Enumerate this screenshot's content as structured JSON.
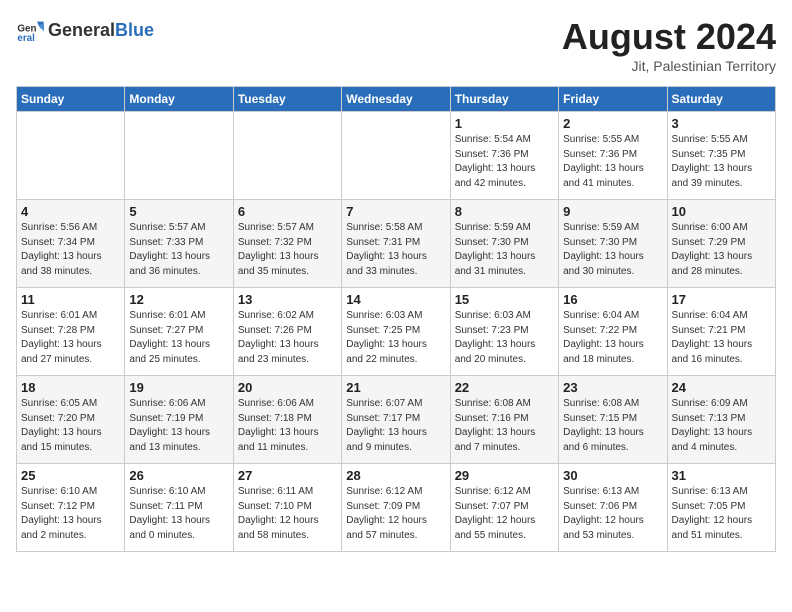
{
  "header": {
    "logo_general": "General",
    "logo_blue": "Blue",
    "month_year": "August 2024",
    "location": "Jit, Palestinian Territory"
  },
  "weekdays": [
    "Sunday",
    "Monday",
    "Tuesday",
    "Wednesday",
    "Thursday",
    "Friday",
    "Saturday"
  ],
  "weeks": [
    [
      {
        "day": "",
        "info": ""
      },
      {
        "day": "",
        "info": ""
      },
      {
        "day": "",
        "info": ""
      },
      {
        "day": "",
        "info": ""
      },
      {
        "day": "1",
        "info": "Sunrise: 5:54 AM\nSunset: 7:36 PM\nDaylight: 13 hours\nand 42 minutes."
      },
      {
        "day": "2",
        "info": "Sunrise: 5:55 AM\nSunset: 7:36 PM\nDaylight: 13 hours\nand 41 minutes."
      },
      {
        "day": "3",
        "info": "Sunrise: 5:55 AM\nSunset: 7:35 PM\nDaylight: 13 hours\nand 39 minutes."
      }
    ],
    [
      {
        "day": "4",
        "info": "Sunrise: 5:56 AM\nSunset: 7:34 PM\nDaylight: 13 hours\nand 38 minutes."
      },
      {
        "day": "5",
        "info": "Sunrise: 5:57 AM\nSunset: 7:33 PM\nDaylight: 13 hours\nand 36 minutes."
      },
      {
        "day": "6",
        "info": "Sunrise: 5:57 AM\nSunset: 7:32 PM\nDaylight: 13 hours\nand 35 minutes."
      },
      {
        "day": "7",
        "info": "Sunrise: 5:58 AM\nSunset: 7:31 PM\nDaylight: 13 hours\nand 33 minutes."
      },
      {
        "day": "8",
        "info": "Sunrise: 5:59 AM\nSunset: 7:30 PM\nDaylight: 13 hours\nand 31 minutes."
      },
      {
        "day": "9",
        "info": "Sunrise: 5:59 AM\nSunset: 7:30 PM\nDaylight: 13 hours\nand 30 minutes."
      },
      {
        "day": "10",
        "info": "Sunrise: 6:00 AM\nSunset: 7:29 PM\nDaylight: 13 hours\nand 28 minutes."
      }
    ],
    [
      {
        "day": "11",
        "info": "Sunrise: 6:01 AM\nSunset: 7:28 PM\nDaylight: 13 hours\nand 27 minutes."
      },
      {
        "day": "12",
        "info": "Sunrise: 6:01 AM\nSunset: 7:27 PM\nDaylight: 13 hours\nand 25 minutes."
      },
      {
        "day": "13",
        "info": "Sunrise: 6:02 AM\nSunset: 7:26 PM\nDaylight: 13 hours\nand 23 minutes."
      },
      {
        "day": "14",
        "info": "Sunrise: 6:03 AM\nSunset: 7:25 PM\nDaylight: 13 hours\nand 22 minutes."
      },
      {
        "day": "15",
        "info": "Sunrise: 6:03 AM\nSunset: 7:23 PM\nDaylight: 13 hours\nand 20 minutes."
      },
      {
        "day": "16",
        "info": "Sunrise: 6:04 AM\nSunset: 7:22 PM\nDaylight: 13 hours\nand 18 minutes."
      },
      {
        "day": "17",
        "info": "Sunrise: 6:04 AM\nSunset: 7:21 PM\nDaylight: 13 hours\nand 16 minutes."
      }
    ],
    [
      {
        "day": "18",
        "info": "Sunrise: 6:05 AM\nSunset: 7:20 PM\nDaylight: 13 hours\nand 15 minutes."
      },
      {
        "day": "19",
        "info": "Sunrise: 6:06 AM\nSunset: 7:19 PM\nDaylight: 13 hours\nand 13 minutes."
      },
      {
        "day": "20",
        "info": "Sunrise: 6:06 AM\nSunset: 7:18 PM\nDaylight: 13 hours\nand 11 minutes."
      },
      {
        "day": "21",
        "info": "Sunrise: 6:07 AM\nSunset: 7:17 PM\nDaylight: 13 hours\nand 9 minutes."
      },
      {
        "day": "22",
        "info": "Sunrise: 6:08 AM\nSunset: 7:16 PM\nDaylight: 13 hours\nand 7 minutes."
      },
      {
        "day": "23",
        "info": "Sunrise: 6:08 AM\nSunset: 7:15 PM\nDaylight: 13 hours\nand 6 minutes."
      },
      {
        "day": "24",
        "info": "Sunrise: 6:09 AM\nSunset: 7:13 PM\nDaylight: 13 hours\nand 4 minutes."
      }
    ],
    [
      {
        "day": "25",
        "info": "Sunrise: 6:10 AM\nSunset: 7:12 PM\nDaylight: 13 hours\nand 2 minutes."
      },
      {
        "day": "26",
        "info": "Sunrise: 6:10 AM\nSunset: 7:11 PM\nDaylight: 13 hours\nand 0 minutes."
      },
      {
        "day": "27",
        "info": "Sunrise: 6:11 AM\nSunset: 7:10 PM\nDaylight: 12 hours\nand 58 minutes."
      },
      {
        "day": "28",
        "info": "Sunrise: 6:12 AM\nSunset: 7:09 PM\nDaylight: 12 hours\nand 57 minutes."
      },
      {
        "day": "29",
        "info": "Sunrise: 6:12 AM\nSunset: 7:07 PM\nDaylight: 12 hours\nand 55 minutes."
      },
      {
        "day": "30",
        "info": "Sunrise: 6:13 AM\nSunset: 7:06 PM\nDaylight: 12 hours\nand 53 minutes."
      },
      {
        "day": "31",
        "info": "Sunrise: 6:13 AM\nSunset: 7:05 PM\nDaylight: 12 hours\nand 51 minutes."
      }
    ]
  ]
}
